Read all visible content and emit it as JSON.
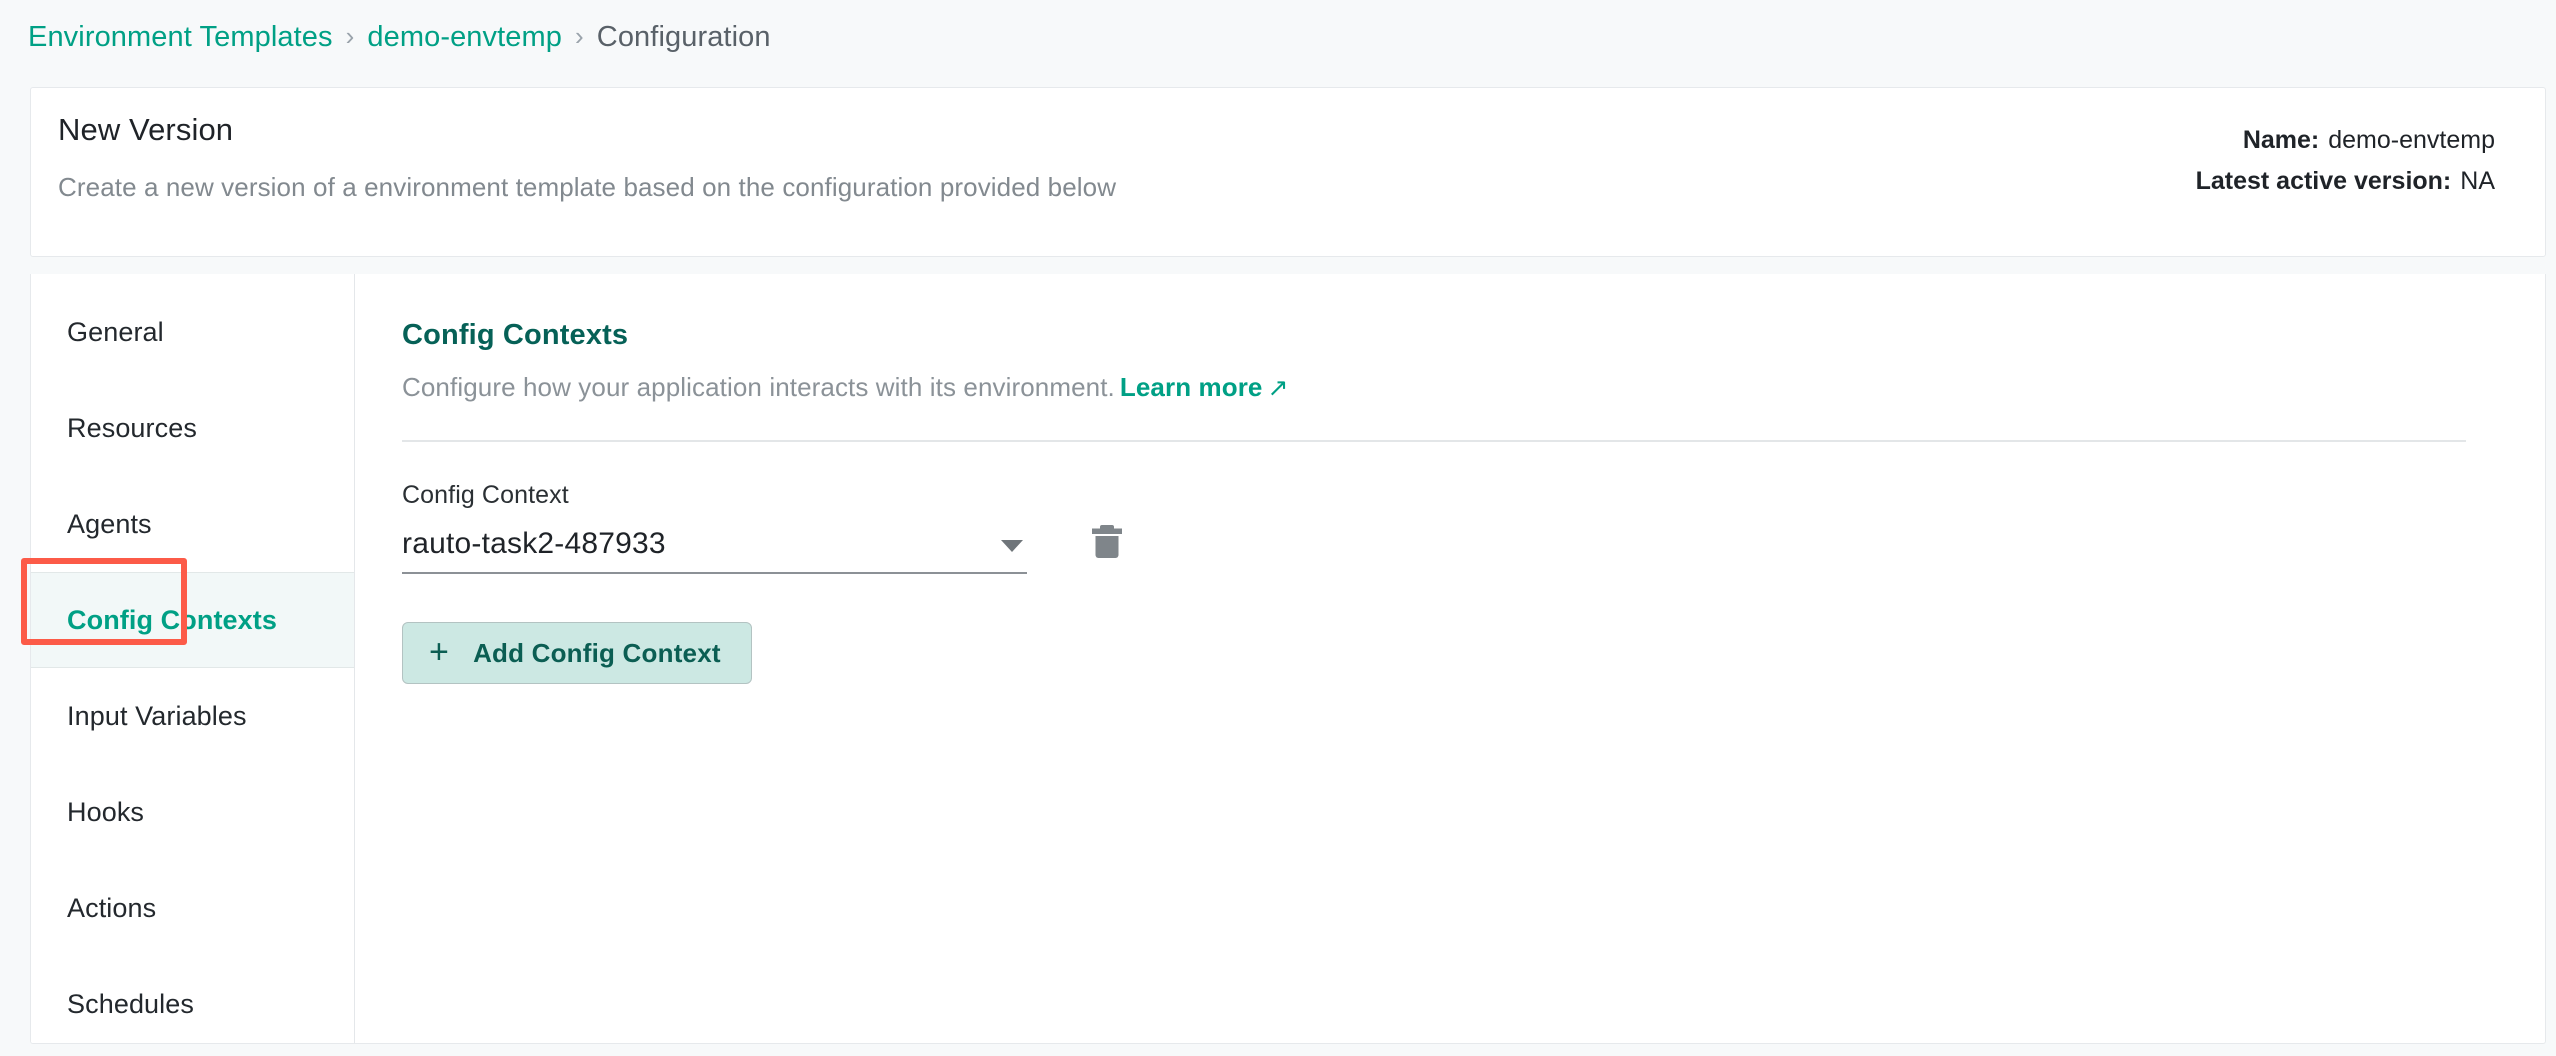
{
  "breadcrumb": {
    "items": [
      {
        "label": "Environment Templates",
        "type": "link"
      },
      {
        "label": "demo-envtemp",
        "type": "link"
      },
      {
        "label": "Configuration",
        "type": "current"
      }
    ],
    "separator": "›"
  },
  "header": {
    "title": "New Version",
    "subtitle": "Create a new version of a environment template based on the configuration provided below",
    "meta": [
      {
        "key": "Name:",
        "value": "demo-envtemp"
      },
      {
        "key": "Latest active version:",
        "value": "NA"
      }
    ]
  },
  "sidebar": {
    "items": [
      {
        "label": "General",
        "active": false
      },
      {
        "label": "Resources",
        "active": false
      },
      {
        "label": "Agents",
        "active": false
      },
      {
        "label": "Config Contexts",
        "active": true
      },
      {
        "label": "Input Variables",
        "active": false
      },
      {
        "label": "Hooks",
        "active": false
      },
      {
        "label": "Actions",
        "active": false
      },
      {
        "label": "Schedules",
        "active": false
      }
    ]
  },
  "content": {
    "section_title": "Config Contexts",
    "section_desc": "Configure how your application interacts with its environment.",
    "learn_more_label": "Learn more",
    "external_link_icon": "↗",
    "field_label": "Config Context",
    "field_value": "rauto-task2-487933",
    "delete_icon_name": "trash-icon",
    "add_button_plus": "+",
    "add_button_label": "Add Config Context"
  },
  "colors": {
    "accent_teal": "#00a085",
    "heading_teal": "#066157",
    "annotation_red": "#fc5b48",
    "button_bg": "#cce8e3",
    "page_bg": "#f7f9fa"
  }
}
